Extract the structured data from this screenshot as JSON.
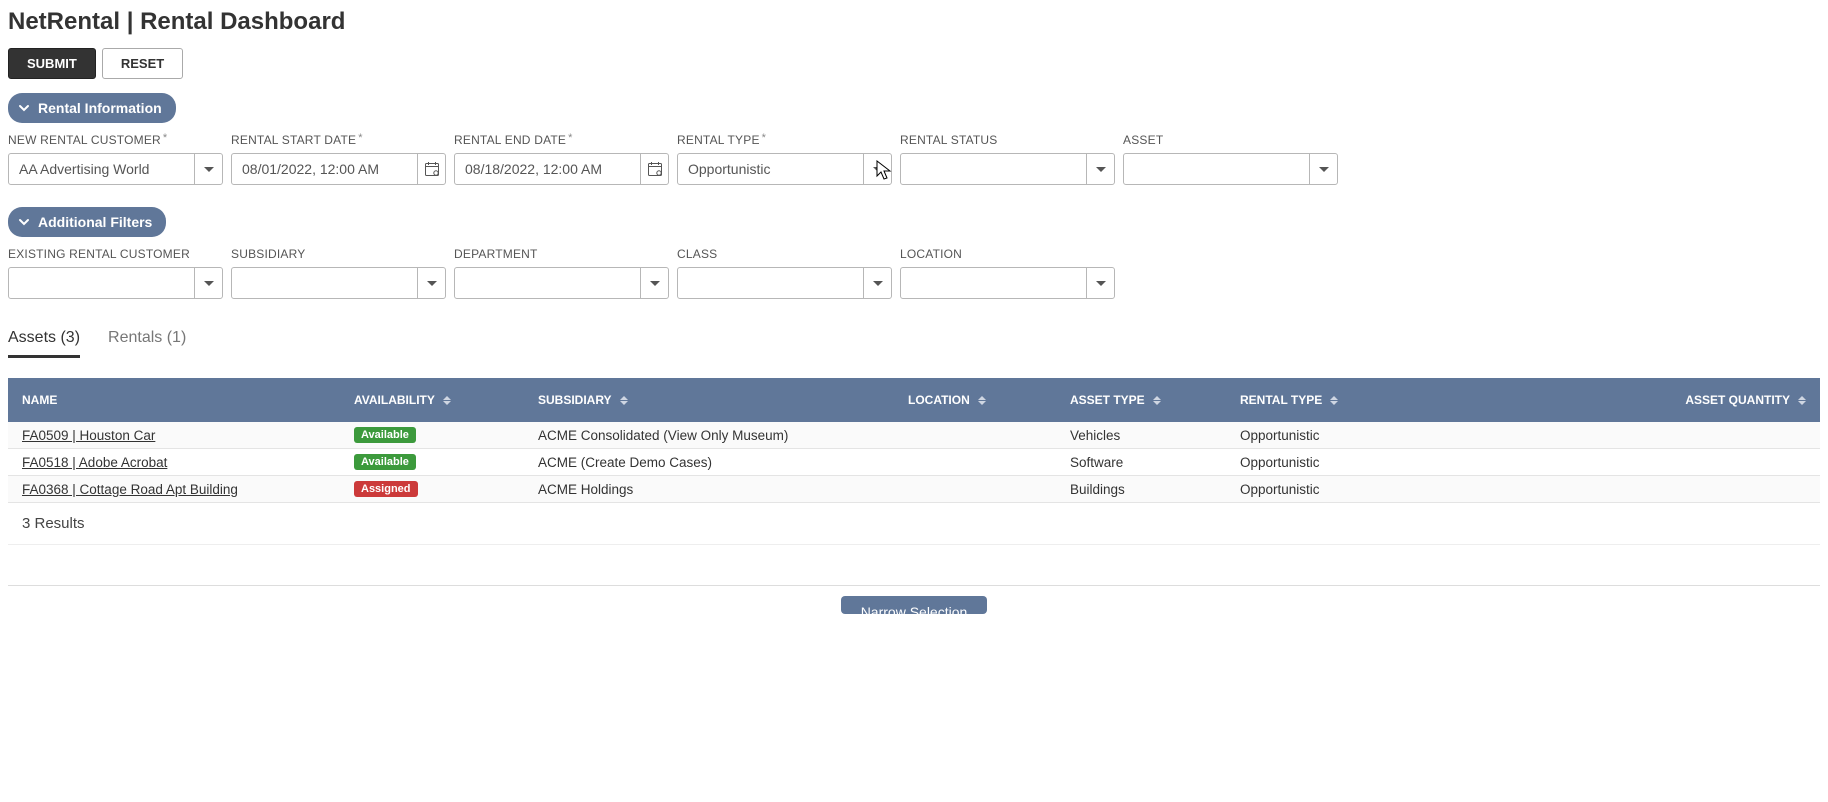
{
  "title": "NetRental | Rental Dashboard",
  "buttons": {
    "submit": "SUBMIT",
    "reset": "RESET"
  },
  "sections": {
    "rental_info": "Rental Information",
    "additional_filters": "Additional Filters"
  },
  "rental_fields": {
    "customer": {
      "label": "NEW RENTAL CUSTOMER",
      "required": true,
      "value": "AA Advertising World"
    },
    "start_date": {
      "label": "RENTAL START DATE",
      "required": true,
      "value": "08/01/2022, 12:00 AM"
    },
    "end_date": {
      "label": "RENTAL END DATE",
      "required": true,
      "value": "08/18/2022, 12:00 AM"
    },
    "rental_type": {
      "label": "RENTAL TYPE",
      "required": true,
      "value": "Opportunistic"
    },
    "rental_status": {
      "label": "RENTAL STATUS",
      "required": false,
      "value": ""
    },
    "asset": {
      "label": "ASSET",
      "required": false,
      "value": ""
    }
  },
  "additional_fields": {
    "existing_customer": {
      "label": "EXISTING RENTAL CUSTOMER",
      "value": ""
    },
    "subsidiary": {
      "label": "SUBSIDIARY",
      "value": ""
    },
    "department": {
      "label": "DEPARTMENT",
      "value": ""
    },
    "class": {
      "label": "CLASS",
      "value": ""
    },
    "location": {
      "label": "LOCATION",
      "value": ""
    }
  },
  "tabs": {
    "assets": "Assets (3)",
    "rentals": "Rentals (1)"
  },
  "columns": {
    "name": "NAME",
    "availability": "AVAILABILITY",
    "subsidiary": "SUBSIDIARY",
    "location": "LOCATION",
    "asset_type": "ASSET TYPE",
    "rental_type": "RENTAL TYPE",
    "asset_quantity": "ASSET QUANTITY"
  },
  "rows": [
    {
      "name": "FA0509 | Houston Car",
      "availability": "Available",
      "avail_color": "green",
      "subsidiary": "ACME Consolidated (View Only Museum)",
      "location": "",
      "asset_type": "Vehicles",
      "rental_type": "Opportunistic"
    },
    {
      "name": "FA0518 | Adobe Acrobat",
      "availability": "Available",
      "avail_color": "green",
      "subsidiary": "ACME (Create Demo Cases)",
      "location": "",
      "asset_type": "Software",
      "rental_type": "Opportunistic"
    },
    {
      "name": "FA0368 | Cottage Road Apt Building",
      "availability": "Assigned",
      "avail_color": "red",
      "subsidiary": "ACME Holdings",
      "location": "",
      "asset_type": "Buildings",
      "rental_type": "Opportunistic"
    }
  ],
  "results_footer": "3 Results",
  "bottom_button": "Narrow Selection"
}
